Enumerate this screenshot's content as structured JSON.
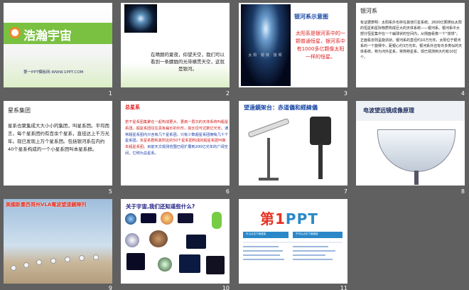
{
  "slides": [
    {
      "number": "1",
      "title": "浩瀚宇宙",
      "subtitle": "第一PPT模板网-WWW.1PPT.COM"
    },
    {
      "number": "2",
      "text": "在晴朗的夏夜，仰望天空，我们可以看到一条朦胧的光带横贯天空，这就是银河。"
    },
    {
      "number": "3",
      "title": "银河系示意图",
      "body": "太阳系是银河系中的一颗普通恒星，银河系中有1000多亿颗像太阳一样的恒星。",
      "caption": "太阳 银核 旋臂"
    },
    {
      "number": "4",
      "title": "银河系",
      "body": "有证据表明：太阳系外也存在其他行星系统。2600亿颗类似太阳的恒星和星际物质构成巨大的天体系统——银河系。银河系中大部分恒星集中在一个扁球状的空间内，从侧面看像一个“铁饼”。正面看去则呈旋涡状。银河系的直径约10万光年，太阳位于银河系的一个旋臂中，距银心约3万光年。银河系外还有许多类似的天体系统，称为河外星系，常简称星系。现已观测到大约有10亿个。"
    },
    {
      "number": "5",
      "title": "星系集团",
      "body": "星系也聚集成大大小小的集团，叫星系团。平均而言，每个星系团约有百余个星系，直径达上千万光年。现已发现上万个星系团。包括银河系在内约40个星系构成的一个小星系团叫本星系群。"
    },
    {
      "number": "6",
      "title": "总星系",
      "body_a": "若干星系团集聚在一起构成更大、更高一层次的天体系统叫超星系团。超星系团往往具有扁长的外形，其长径可达数亿光年。",
      "body_b": "通常超星系团内只含有几个星系团，只有少数超星系团拥有几十个星系团。",
      "body_c": "本星系群和其附近的50个星系团构成的超星系团叫做本超星系团。",
      "body_d": "目前天文观测范围已经扩展到200亿光年的广阔空间，它称为总星系。"
    },
    {
      "number": "7",
      "title": "望遠鏡架台：赤道儀和經緯儀"
    },
    {
      "number": "8",
      "title": "电波望远镜成像原理"
    },
    {
      "number": "9",
      "title": "美國新墨西哥州VLA電波望遠鏡陣列"
    },
    {
      "number": "10",
      "title": "关于宇宙,我们还知道些什么?"
    },
    {
      "number": "11",
      "logo_text": "第",
      "logo_num": "1",
      "logo_rest": "PPT",
      "tab_left": "可以点击下面链接",
      "tab_right": "不可以点击下面链接"
    }
  ],
  "colors": {
    "background": "#606060",
    "green": "#7ac142",
    "red": "#e02020",
    "blue": "#1a4aa5"
  }
}
